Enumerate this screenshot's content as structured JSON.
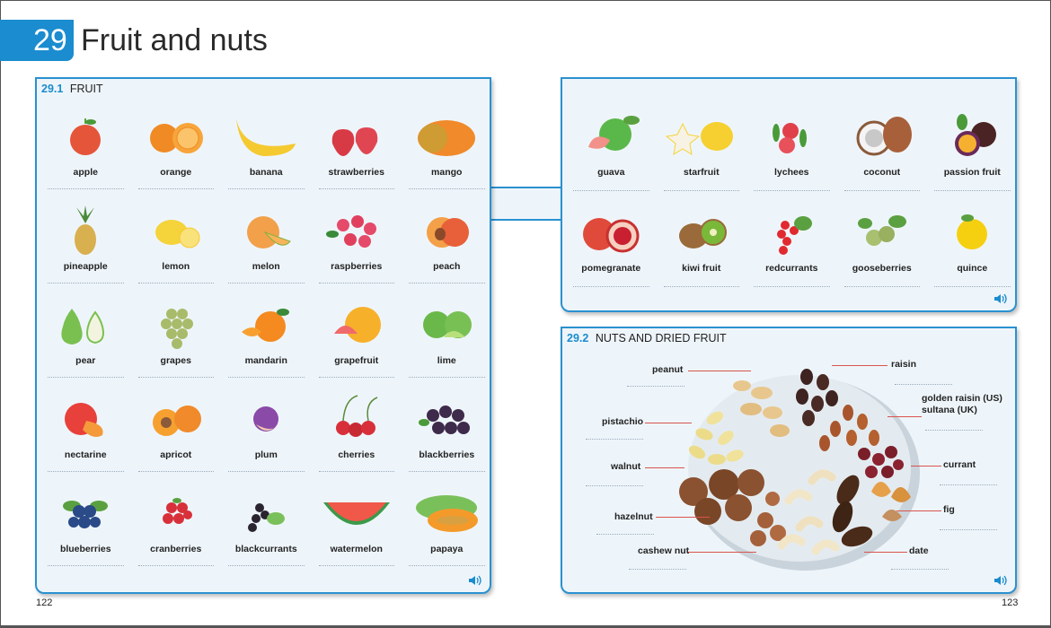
{
  "unit": {
    "number": "29",
    "title": "Fruit and nuts"
  },
  "sections": {
    "fruit": {
      "number": "29.1",
      "title": "FRUIT",
      "items_left": [
        "apple",
        "orange",
        "banana",
        "strawberries",
        "mango",
        "pineapple",
        "lemon",
        "melon",
        "raspberries",
        "peach",
        "pear",
        "grapes",
        "mandarin",
        "grapefruit",
        "lime",
        "nectarine",
        "apricot",
        "plum",
        "cherries",
        "blackberries",
        "blueberries",
        "cranberries",
        "blackcurrants",
        "watermelon",
        "papaya"
      ],
      "items_right": [
        "guava",
        "starfruit",
        "lychees",
        "coconut",
        "passion fruit",
        "pomegranate",
        "kiwi fruit",
        "redcurrants",
        "gooseberries",
        "quince"
      ]
    },
    "nuts": {
      "number": "29.2",
      "title": "NUTS AND DRIED FRUIT",
      "left_labels": [
        "peanut",
        "pistachio",
        "walnut",
        "hazelnut",
        "cashew nut"
      ],
      "right_labels": [
        "raisin",
        "golden raisin (US)",
        "sultana (UK)",
        "currant",
        "fig",
        "date"
      ]
    }
  },
  "audio": {
    "icon": "speaker-icon"
  },
  "pages": {
    "left": "122",
    "right": "123"
  },
  "colors": {
    "accent": "#1a8ccf",
    "panel_bg": "#eef5fa",
    "border": "#2a91d0",
    "leader": "#d9534f"
  }
}
